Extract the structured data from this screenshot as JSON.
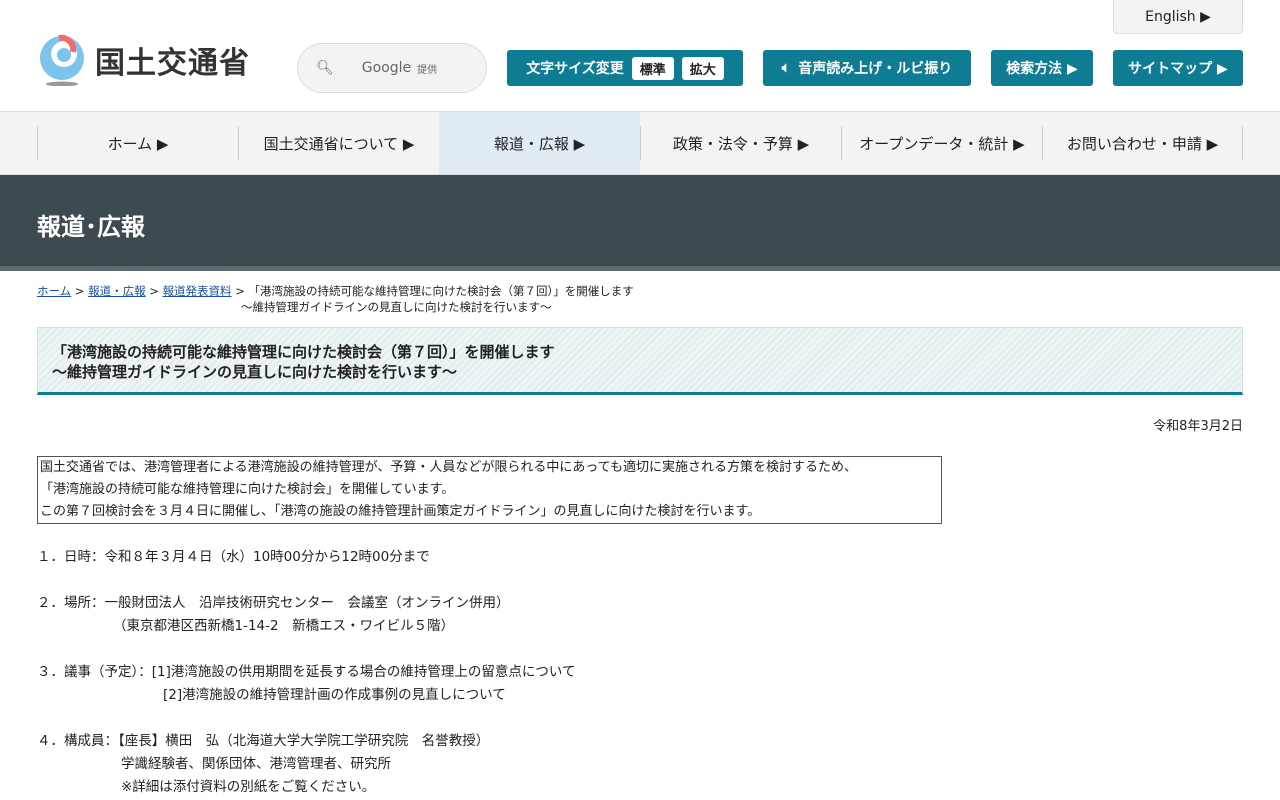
{
  "header": {
    "logo_text": "国土交通省",
    "search_brand": "Google",
    "search_provided": "提供",
    "english": "English ▶",
    "font_size_label": "文字サイズ変更",
    "font_standard": "標準",
    "font_large": "拡大",
    "read_aloud": "音声読み上げ・ルビ振り",
    "search_method": "検索方法 ▶",
    "sitemap": "サイトマップ ▶"
  },
  "nav": [
    "ホーム ▶",
    "国土交通省について ▶",
    "報道・広報 ▶",
    "政策・法令・予算 ▶",
    "オープンデータ・統計 ▶",
    "お問い合わせ・申請 ▶"
  ],
  "band_title": "報道･広報",
  "breadcrumb": {
    "home": "ホーム",
    "press": "報道・広報",
    "releases": "報道発表資料",
    "sep": " > ",
    "current1": "「港湾施設の持続可能な維持管理に向けた検討会（第７回）」を開催します",
    "current2": "～維持管理ガイドラインの見直しに向けた検討を行います～"
  },
  "title": {
    "line1": "「港湾施設の持続可能な維持管理に向けた検討会（第７回）」を開催します",
    "line2": "～維持管理ガイドラインの見直しに向けた検討を行います～"
  },
  "date": "令和8年3月2日",
  "intro": [
    "国土交通省では、港湾管理者による港湾施設の維持管理が、予算・人員などが限られる中にあっても適切に実施される方策を検討するため、",
    "「港湾施設の持続可能な維持管理に向けた検討会」を開催しています。",
    "この第７回検討会を３月４日に開催し、「港湾の施設の維持管理計画策定ガイドライン」の見直しに向けた検討を行います。"
  ],
  "items": {
    "datetime": "１．日時：令和８年３月４日（水）10時00分から12時00分まで",
    "place1": "２．場所：一般財団法人　沿岸技術研究センター　会議室（オンライン併用）",
    "place2": "（東京都港区西新橋1-14-2　新橋エス・ワイビル５階）",
    "agenda1": "３．議事（予定）：[1]港湾施設の供用期間を延長する場合の維持管理上の留意点について",
    "agenda2": "[2]港湾施設の維持管理計画の作成事例の見直しについて",
    "members1": "４．構成員：【座長】横田　弘（北海道大学大学院工学研究院　名誉教授）",
    "members2": "学識経験者、関係団体、港湾管理者、研究所",
    "members3": "※詳細は添付資料の別紙をご覧ください。"
  }
}
